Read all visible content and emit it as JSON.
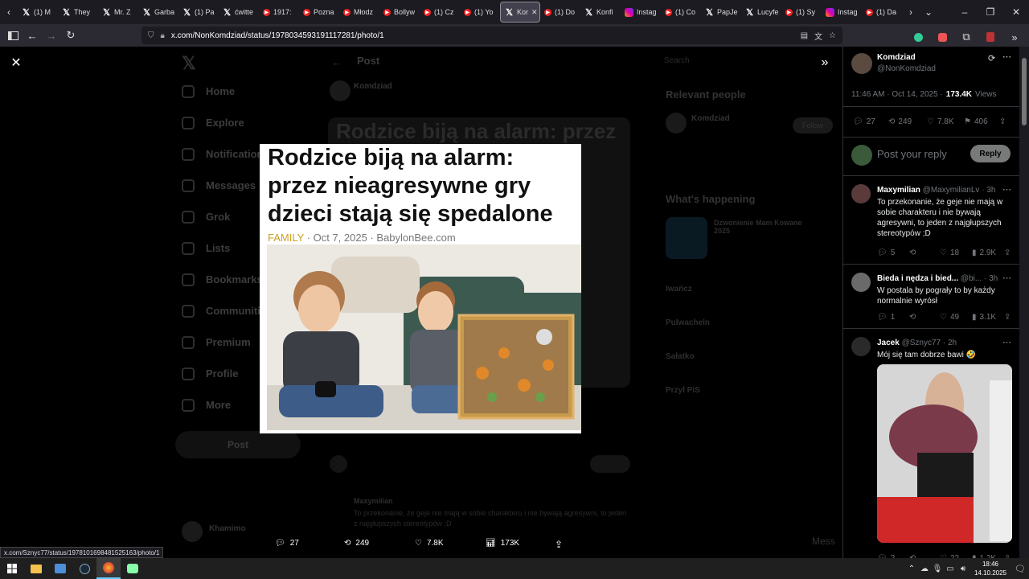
{
  "browser": {
    "tabs": [
      {
        "label": "(1) M",
        "icon": "x-icon"
      },
      {
        "label": "They",
        "icon": "x-icon"
      },
      {
        "label": "Mr. Z",
        "icon": "x-icon"
      },
      {
        "label": "Garba",
        "icon": "x-icon"
      },
      {
        "label": "(1) Pa",
        "icon": "x-icon"
      },
      {
        "label": "ćwitte",
        "icon": "x-icon"
      },
      {
        "label": "1917:",
        "icon": "youtube-icon"
      },
      {
        "label": "Pozna",
        "icon": "youtube-icon"
      },
      {
        "label": "Młodz",
        "icon": "youtube-icon"
      },
      {
        "label": "Bollyw",
        "icon": "youtube-icon"
      },
      {
        "label": "(1) Cz",
        "icon": "youtube-icon"
      },
      {
        "label": "(1) Yo",
        "icon": "youtube-icon"
      },
      {
        "label": "Kor",
        "icon": "x-icon",
        "active": true
      },
      {
        "label": "(1) Do",
        "icon": "youtube-icon"
      },
      {
        "label": "Konfi",
        "icon": "x-icon"
      },
      {
        "label": "Instag",
        "icon": "instagram-icon"
      },
      {
        "label": "(1) Co",
        "icon": "youtube-icon"
      },
      {
        "label": "PapJe",
        "icon": "x-icon"
      },
      {
        "label": "Lucyfe",
        "icon": "x-icon"
      },
      {
        "label": "(1) Sy",
        "icon": "youtube-icon"
      },
      {
        "label": "Instag",
        "icon": "instagram-icon"
      },
      {
        "label": "(1) Da",
        "icon": "youtube-icon"
      }
    ],
    "url": "x.com/NonKomdziad/status/1978034593191117281/photo/1",
    "status_url": "x.com/Sznyc77/status/1978101698481525163/photo/1"
  },
  "background": {
    "nav_items": [
      "Home",
      "Explore",
      "Notifications",
      "Messages",
      "Grok",
      "Lists",
      "Bookmarks",
      "Communities",
      "Premium",
      "Profile",
      "More"
    ],
    "post_button": "Post",
    "header": "Post",
    "author": "Komdziad",
    "relevant_people_title": "Relevant people",
    "whats_happening": "What's happening",
    "search": "Search",
    "follow": "Follow",
    "trend_title": "Dzwonienie Mam Kowane 2025",
    "trends": [
      "Iwańcz",
      "Pulwacheln",
      "Sałatko",
      "Przył PiS"
    ],
    "reply_author": "Maxymilian",
    "reply_preview": "To przekonanie, że geje nie mają w sobie charakteru i nie bywają agresywni, to jeden z najgłupszych stereotypów ;D",
    "messages": "Mess",
    "profile_name": "Khamimo"
  },
  "article": {
    "headline": "Rodzice biją na alarm: przez nieagresywne gry dzieci stają się spedalone",
    "category": "FAMILY",
    "meta": "· Oct 7, 2025 · BabylonBee.com"
  },
  "photo_actions": {
    "replies": "27",
    "reposts": "249",
    "likes": "7.8K",
    "views": "173K"
  },
  "panel": {
    "author_name": "Komdziad",
    "author_handle": "@NonKomdziad",
    "timestamp": "11:46 AM · Oct 14, 2025 ·",
    "views_count": "173.4K",
    "views_label": "Views",
    "stats": {
      "replies": "27",
      "reposts": "249",
      "likes": "7.8K",
      "bookmarks": "406"
    },
    "reply_placeholder": "Post your reply",
    "reply_button": "Reply",
    "replies": [
      {
        "name": "Maxymilian",
        "handle": "@MaxymilianLv · 3h",
        "text": "To przekonanie, że geje nie mają w sobie charakteru i nie bywają agresywni, to jeden z najgłupszych stereotypów ;D",
        "replies": "5",
        "reposts": "",
        "likes": "18",
        "views": "2.9K"
      },
      {
        "name": "Bieda i nędza i bied...",
        "handle": "@bi... · 3h",
        "text": "W postala by pograły to by każdy normalnie wyrósł",
        "replies": "1",
        "reposts": "",
        "likes": "49",
        "views": "3.1K"
      },
      {
        "name": "Jacek",
        "handle": "@Sznyc77 · 2h",
        "text": "Mój się tam dobrze bawi 🤣",
        "replies": "2",
        "reposts": "",
        "likes": "22",
        "views": "1.2K"
      }
    ]
  },
  "taskbar": {
    "time": "18:46",
    "date": "14.10.2025"
  },
  "colors": {
    "accent": "#1d9bf0",
    "family": "#c9a227",
    "panel_bg": "#000000",
    "muted": "#71767b"
  }
}
